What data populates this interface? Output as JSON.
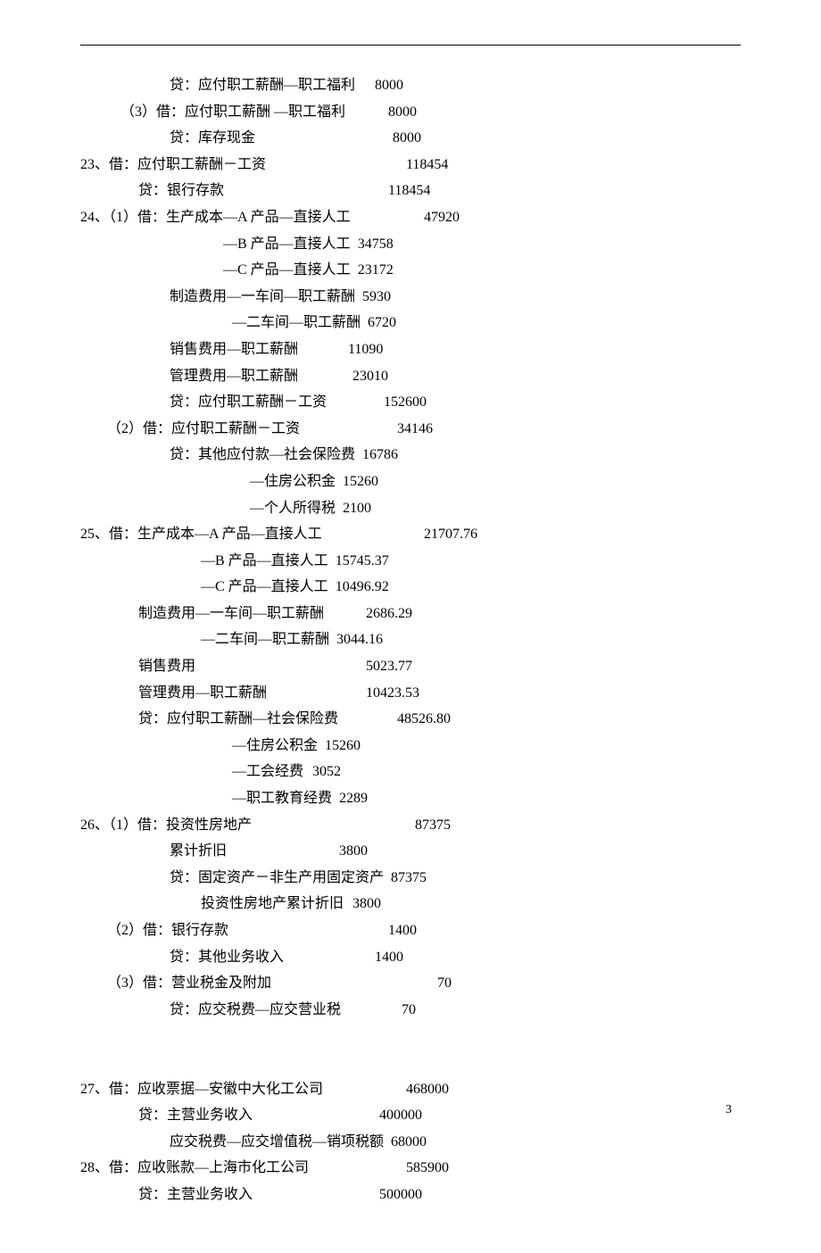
{
  "page_number": "3",
  "lines": [
    {
      "indent": 190,
      "label": "贷：应付职工薪酬—职工福利",
      "valCol": 520,
      "value": "8000"
    },
    {
      "indent": 135,
      "label": "（3）借：应付职工薪酬 —职工福利",
      "valCol": 480,
      "value": "8000"
    },
    {
      "indent": 190,
      "label": "贷：库存现金",
      "valCol": 540,
      "value": "8000"
    },
    {
      "indent": 90,
      "label": "23、借：应付职工薪酬－工资",
      "valCol": 455,
      "value": "118454"
    },
    {
      "indent": 155,
      "label": "贷：银行存款",
      "valCol": 500,
      "value": "118454"
    },
    {
      "indent": 90,
      "label": "24、（1）借：生产成本—A 产品—直接人工",
      "valCol": 475,
      "value": "47920"
    },
    {
      "indent": 250,
      "label": "—B 产品—直接人工",
      "valCol": 475,
      "value": "34758"
    },
    {
      "indent": 250,
      "label": "—C 产品—直接人工",
      "valCol": 475,
      "value": "23172"
    },
    {
      "indent": 190,
      "label": "制造费用—一车间—职工薪酬",
      "valCol": 495,
      "value": "5930"
    },
    {
      "indent": 260,
      "label": "—二车间—职工薪酬",
      "valCol": 495,
      "value": "6720"
    },
    {
      "indent": 190,
      "label": "销售费用—职工薪酬",
      "valCol": 490,
      "value": "11090"
    },
    {
      "indent": 190,
      "label": "管理费用—职工薪酬",
      "valCol": 495,
      "value": "23010"
    },
    {
      "indent": 190,
      "label": "贷：应付职工薪酬－工资",
      "valCol": 530,
      "value": "152600"
    },
    {
      "indent": 120,
      "label": "（2）借：应付职工薪酬－工资",
      "valCol": 475,
      "value": "34146"
    },
    {
      "indent": 190,
      "label": "贷：其他应付款—社会保险费",
      "valCol": 505,
      "value": "16786"
    },
    {
      "indent": 280,
      "label": "—住房公积金",
      "valCol": 505,
      "value": "15260"
    },
    {
      "indent": 280,
      "label": "—个人所得税",
      "valCol": 510,
      "value": "2100"
    },
    {
      "indent": 90,
      "label": "25、借：生产成本—A 产品—直接人工",
      "valCol": 475,
      "value": "21707.76"
    },
    {
      "indent": 225,
      "label": "—B 产品—直接人工",
      "valCol": 475,
      "value": "15745.37"
    },
    {
      "indent": 225,
      "label": "—C 产品—直接人工",
      "valCol": 475,
      "value": "10496.92"
    },
    {
      "indent": 155,
      "label": "制造费用—一车间—职工薪酬",
      "valCol": 475,
      "value": "2686.29"
    },
    {
      "indent": 225,
      "label": "—二车间—职工薪酬",
      "valCol": 475,
      "value": "3044.16"
    },
    {
      "indent": 155,
      "label": "销售费用",
      "valCol": 475,
      "value": "5023.77"
    },
    {
      "indent": 155,
      "label": "管理费用—职工薪酬",
      "valCol": 475,
      "value": "10423.53"
    },
    {
      "indent": 155,
      "label": "贷：应付职工薪酬—社会保险费",
      "valCol": 510,
      "value": "48526.80"
    },
    {
      "indent": 260,
      "label": "—住房公积金",
      "valCol": 510,
      "value": "15260"
    },
    {
      "indent": 260,
      "label": "—工会经费",
      "valCol": 520,
      "value": "3052"
    },
    {
      "indent": 260,
      "label": "—职工教育经费",
      "valCol": 520,
      "value": "2289"
    },
    {
      "indent": 90,
      "label": "26、（1）借：投资性房地产",
      "valCol": 465,
      "value": "87375"
    },
    {
      "indent": 190,
      "label": "累计折旧",
      "valCol": 480,
      "value": "3800"
    },
    {
      "indent": 190,
      "label": "贷：固定资产－非生产用固定资产",
      "valCol": 520,
      "value": "87375"
    },
    {
      "indent": 225,
      "label": "投资性房地产累计折旧",
      "valCol": 530,
      "value": "3800"
    },
    {
      "indent": 120,
      "label": "（2）借：银行存款",
      "valCol": 465,
      "value": "1400"
    },
    {
      "indent": 190,
      "label": "贷：其他业务收入",
      "valCol": 520,
      "value": "1400"
    },
    {
      "indent": 120,
      "label": "（3）借：营业税金及附加",
      "valCol": 520,
      "value": "70"
    },
    {
      "indent": 190,
      "label": "贷：应交税费—应交营业税",
      "valCol": 550,
      "value": "70"
    },
    {
      "indent": 0,
      "label": "",
      "valCol": 0,
      "value": "",
      "spacer": true
    },
    {
      "indent": 0,
      "label": "",
      "valCol": 0,
      "value": "",
      "spacer": true
    },
    {
      "indent": 90,
      "label": "27、借：应收票据—安徽中大化工公司",
      "valCol": 455,
      "value": "468000"
    },
    {
      "indent": 155,
      "label": "贷：主营业务收入",
      "valCol": 490,
      "value": "400000"
    },
    {
      "indent": 190,
      "label": "应交税费—应交增值税—销项税额",
      "valCol": 500,
      "value": "68000"
    },
    {
      "indent": 90,
      "label": "28、借：应收账款—上海市化工公司",
      "valCol": 455,
      "value": "585900"
    },
    {
      "indent": 155,
      "label": "贷：主营业务收入",
      "valCol": 490,
      "value": "500000"
    }
  ]
}
